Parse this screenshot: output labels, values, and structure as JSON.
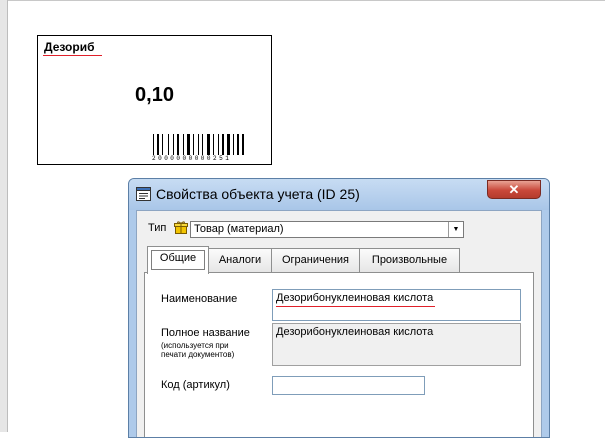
{
  "label_preview": {
    "name": "Дезориб",
    "price": "0,10",
    "barcode_digits": "2000000000251"
  },
  "dialog": {
    "title": "Свойства объекта учета  (ID 25)",
    "close_symbol": "✕",
    "type_label": "Тип",
    "type_value": "Товар (материал)",
    "tabs": [
      {
        "label": "Общие",
        "active": true
      },
      {
        "label": "Аналоги",
        "active": false
      },
      {
        "label": "Ограничения",
        "active": false
      },
      {
        "label": "Произвольные",
        "active": false
      }
    ],
    "fields": {
      "name_label": "Наименование",
      "name_value": "Дезорибонуклеиновая кислота",
      "full_name_label": "Полное название",
      "full_name_hint_1": "(используется при",
      "full_name_hint_2": "печати документов)",
      "full_name_value": "Дезорибонуклеиновая кислота",
      "code_label": "Код (артикул)",
      "code_value": ""
    }
  },
  "icons": {
    "title": "properties-window-icon",
    "type": "gift-box-icon",
    "dropdown": "chevron-down-icon"
  },
  "colors": {
    "spellcheck_underline": "#e0202a",
    "titlebar": "#aecaea",
    "close_button": "#c9483a"
  }
}
